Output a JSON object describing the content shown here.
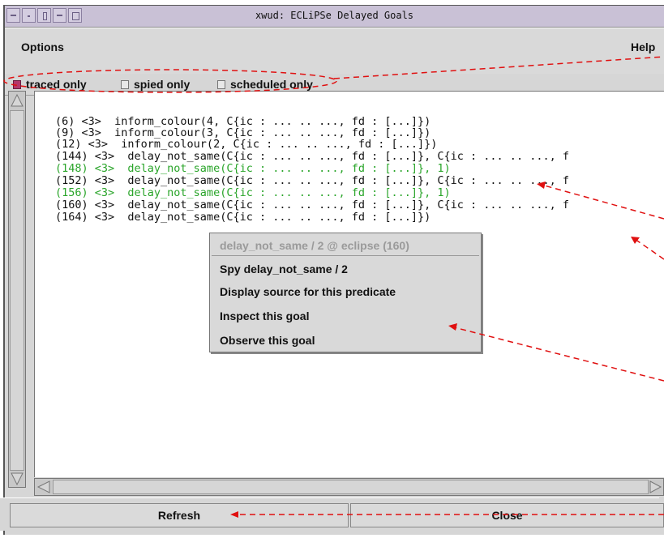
{
  "window": {
    "title": "xwud: ECLiPSe Delayed Goals"
  },
  "menubar": {
    "options_label": "Options",
    "help_label": "Help"
  },
  "filters": [
    {
      "label": "traced only",
      "checked": true
    },
    {
      "label": "spied only",
      "checked": false
    },
    {
      "label": "scheduled only",
      "checked": false
    }
  ],
  "goals": [
    {
      "text": "(6) <3>  inform_colour(4, C{ic : ... .. ..., fd : [...]})",
      "color": "black"
    },
    {
      "text": "(9) <3>  inform_colour(3, C{ic : ... .. ..., fd : [...]})",
      "color": "black"
    },
    {
      "text": "(12) <3>  inform_colour(2, C{ic : ... .. ..., fd : [...]})",
      "color": "black"
    },
    {
      "text": "(144) <3>  delay_not_same(C{ic : ... .. ..., fd : [...]}, C{ic : ... .. ..., f",
      "color": "black"
    },
    {
      "text": "(148) <3>  delay_not_same(C{ic : ... .. ..., fd : [...]}, 1)",
      "color": "green"
    },
    {
      "text": "(152) <3>  delay_not_same(C{ic : ... .. ..., fd : [...]}, C{ic : ... .. ..., f",
      "color": "black"
    },
    {
      "text": "(156) <3>  delay_not_same(C{ic : ... .. ..., fd : [...]}, 1)",
      "color": "green"
    },
    {
      "text": "(160) <3>  delay_not_same(C{ic : ... .. ..., fd : [...]}, C{ic : ... .. ..., f",
      "color": "black"
    },
    {
      "text": "(164) <3>  delay_not_same(C{ic : ... .. ..., fd : [...]})",
      "color": "black"
    }
  ],
  "context_menu": {
    "header": "delay_not_same / 2 @ eclipse (160)",
    "items": [
      "Spy delay_not_same / 2",
      "Display source for this predicate",
      "Inspect this goal",
      "Observe this goal"
    ]
  },
  "buttons": {
    "refresh_label": "Refresh",
    "close_label": "Close"
  },
  "colors": {
    "green_goal": "#2aa52a",
    "checked_box": "#b3366b",
    "annotation_red": "#e01010"
  }
}
